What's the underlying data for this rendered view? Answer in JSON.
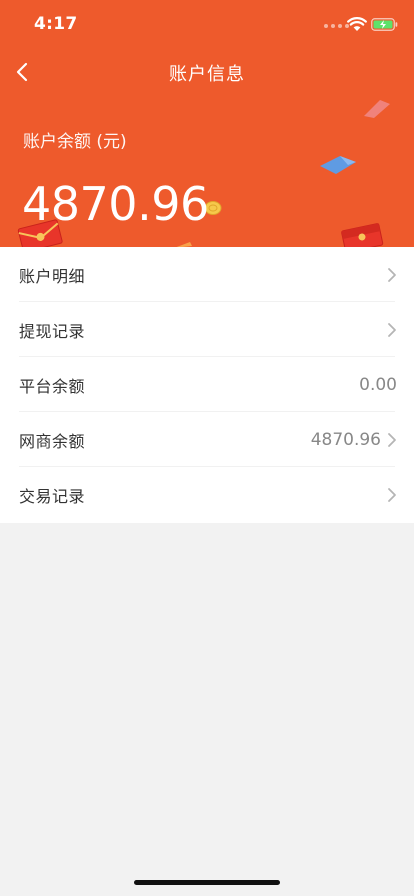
{
  "status_bar": {
    "time": "4:17"
  },
  "nav": {
    "title": "账户信息"
  },
  "balance": {
    "label": "账户余额 (元)",
    "value": "4870.96"
  },
  "menu": {
    "items": [
      {
        "label": "账户明细",
        "value": "",
        "chevron": true
      },
      {
        "label": "提现记录",
        "value": "",
        "chevron": true
      },
      {
        "label": "平台余额",
        "value": "0.00",
        "chevron": false
      },
      {
        "label": "网商余额",
        "value": "4870.96",
        "chevron": true
      },
      {
        "label": "交易记录",
        "value": "",
        "chevron": true
      }
    ]
  },
  "colors": {
    "header_bg": "#ee5a2c",
    "page_bg": "#f2f2f2",
    "text": "#333333",
    "muted": "#888888"
  },
  "icons": [
    "back-arrow-icon",
    "chevron-right-icon",
    "wifi-icon",
    "battery-charging-icon"
  ]
}
